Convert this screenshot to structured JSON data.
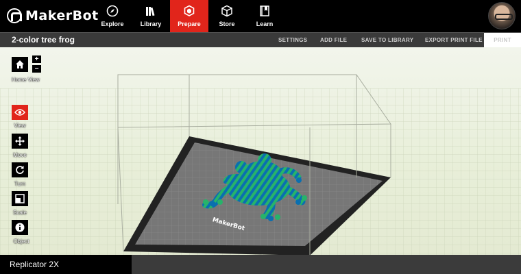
{
  "brand": {
    "name": "MakerBot"
  },
  "nav": {
    "items": [
      {
        "label": "Explore",
        "icon": "compass-icon"
      },
      {
        "label": "Library",
        "icon": "books-icon"
      },
      {
        "label": "Prepare",
        "icon": "prepare-cube-icon",
        "active": true
      },
      {
        "label": "Store",
        "icon": "box-icon"
      },
      {
        "label": "Learn",
        "icon": "book-icon"
      }
    ],
    "accent_color": "#e1251b"
  },
  "toolbar": {
    "file_title": "2-color tree frog",
    "settings": "SETTINGS",
    "add_file": "ADD FILE",
    "save_to_library": "SAVE TO LIBRARY",
    "export_print_file": "EXPORT PRINT FILE",
    "print": "PRINT"
  },
  "tools": {
    "home_view": "Home View",
    "zoom_in": "+",
    "zoom_out": "−",
    "view": "View",
    "move": "Move",
    "turn": "Turn",
    "scale": "Scale",
    "object": "Object"
  },
  "scene": {
    "plate_brand": "MakerBot",
    "model_colors": [
      "#0a6fb0",
      "#27b36a"
    ]
  },
  "status": {
    "printer": "Replicator 2X"
  }
}
